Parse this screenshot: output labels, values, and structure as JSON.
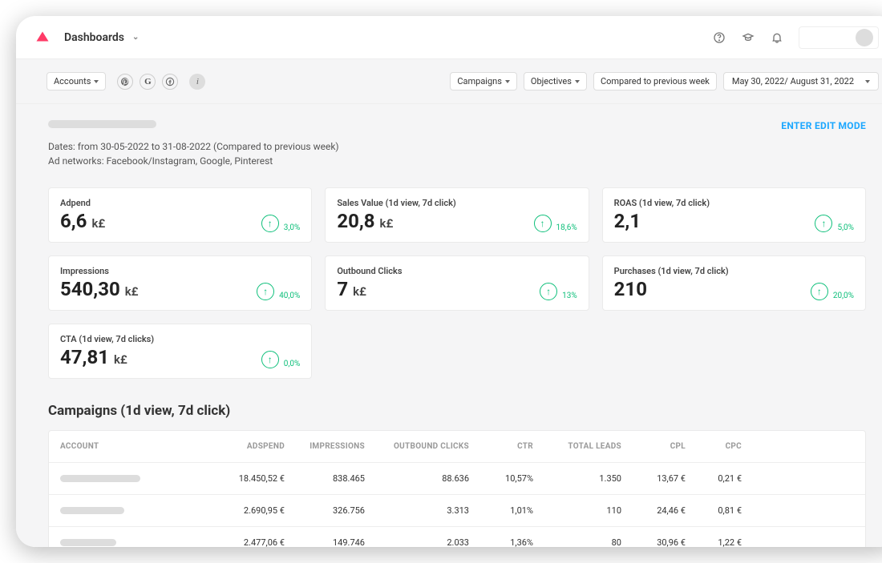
{
  "topbar": {
    "title": "Dashboards"
  },
  "toolbar": {
    "accounts_label": "Accounts",
    "campaigns_label": "Campaigns",
    "objectives_label": "Objectives",
    "compare_label": "Compared to previous week",
    "date_range": "May 30, 2022/ August 31, 2022"
  },
  "meta": {
    "dates": "Dates: from 30-05-2022 to 31-08-2022 (Compared to previous week)",
    "networks": "Ad networks: Facebook/Instagram, Google, Pinterest"
  },
  "edit_mode_label": "ENTER EDIT MODE",
  "kpis": [
    {
      "label": "Adpend",
      "value": "6,6",
      "unit": "k£",
      "delta": "3,0%"
    },
    {
      "label": "Sales Value (1d view, 7d click)",
      "value": "20,8",
      "unit": "k£",
      "delta": "18,6%"
    },
    {
      "label": "ROAS (1d view, 7d click)",
      "value": "2,1",
      "unit": "",
      "delta": "5,0%"
    },
    {
      "label": "Impressions",
      "value": "540,30",
      "unit": "k£",
      "delta": "40,0%"
    },
    {
      "label": "Outbound Clicks",
      "value": "7",
      "unit": "k£",
      "delta": "13%"
    },
    {
      "label": "Purchases (1d view, 7d click)",
      "value": "210",
      "unit": "",
      "delta": "20,0%"
    },
    {
      "label": "CTA (1d view, 7d clicks)",
      "value": "47,81",
      "unit": "k£",
      "delta": "0,0%"
    }
  ],
  "section_title": "Campaigns (1d view, 7d click)",
  "table": {
    "headers": [
      "ACCOUNT",
      "ADSPEND",
      "IMPRESSIONS",
      "OUTBOUND CLICKS",
      "CTR",
      "TOTAL LEADS",
      "CPL",
      "CPC"
    ],
    "rows": [
      {
        "adspend": "18.450,52 €",
        "impressions": "838.465",
        "clicks": "88.636",
        "ctr": "10,57%",
        "leads": "1.350",
        "cpl": "13,67 €",
        "cpc": "0,21 €"
      },
      {
        "adspend": "2.690,95 €",
        "impressions": "326.756",
        "clicks": "3.313",
        "ctr": "1,01%",
        "leads": "110",
        "cpl": "24,46 €",
        "cpc": "0,81 €"
      },
      {
        "adspend": "2.477,06 €",
        "impressions": "149.746",
        "clicks": "2.033",
        "ctr": "1,36%",
        "leads": "80",
        "cpl": "30,96 €",
        "cpc": "1,22 €"
      }
    ]
  }
}
